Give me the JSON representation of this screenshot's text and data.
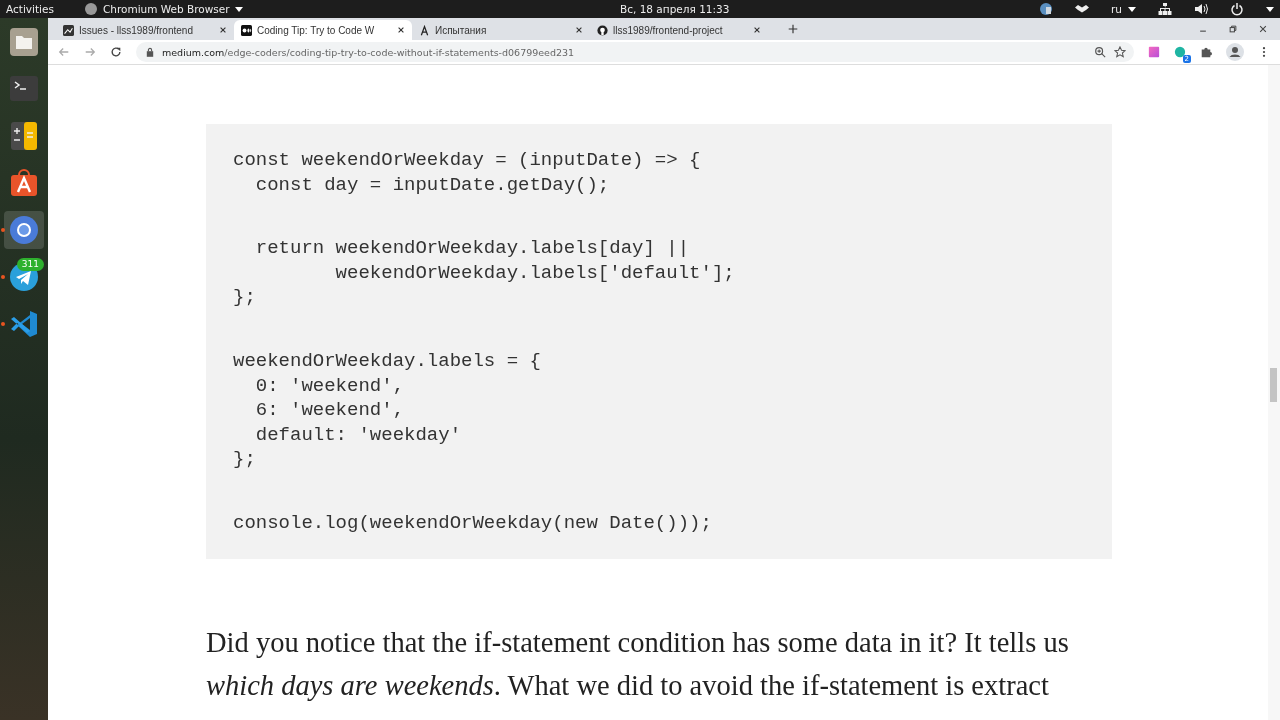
{
  "top_bar": {
    "activities": "Activities",
    "app_menu": "Chromium Web Browser",
    "clock": "Вс, 18 апреля  11:33",
    "keyboard_layout": "ru"
  },
  "dock": {
    "items": [
      {
        "kind": "files",
        "running": false,
        "selected": false
      },
      {
        "kind": "terminal",
        "running": false,
        "selected": false
      },
      {
        "kind": "calculator",
        "running": false,
        "selected": false
      },
      {
        "kind": "store",
        "running": false,
        "selected": false
      },
      {
        "kind": "chromium",
        "running": true,
        "selected": true
      },
      {
        "kind": "telegram",
        "running": true,
        "selected": false,
        "badge": "311"
      },
      {
        "kind": "vscode",
        "running": true,
        "selected": false
      }
    ]
  },
  "browser": {
    "tabs": [
      {
        "title": "Issues - llss1989/frontend",
        "kind": "chart",
        "selected": false
      },
      {
        "title": "Coding Tip: Try to Code W",
        "kind": "medium",
        "selected": true
      },
      {
        "title": "Испытания",
        "kind": "letter",
        "selected": false
      },
      {
        "title": "llss1989/frontend-project",
        "kind": "github",
        "selected": false
      }
    ],
    "url_domain": "medium.com",
    "url_path": "/edge-coders/coding-tip-try-to-code-without-if-statements-d06799eed231",
    "extension_badge": "2"
  },
  "article": {
    "code_blocks": [
      [
        "const weekendOrWeekday = (inputDate) => {",
        "  const day = inputDate.getDay();"
      ],
      [
        "  return weekendOrWeekday.labels[day] ||",
        "         weekendOrWeekday.labels['default'];",
        "};"
      ],
      [
        "weekendOrWeekday.labels = {",
        "  0: 'weekend',",
        "  6: 'weekend',",
        "  default: 'weekday'",
        "};"
      ],
      [
        "console.log(weekendOrWeekday(new Date()));"
      ]
    ],
    "paragraph": "Did you notice that the if-statement condition has some data in it? It tells us *which days are weekends*. What we did to avoid the if-statement is extract"
  }
}
